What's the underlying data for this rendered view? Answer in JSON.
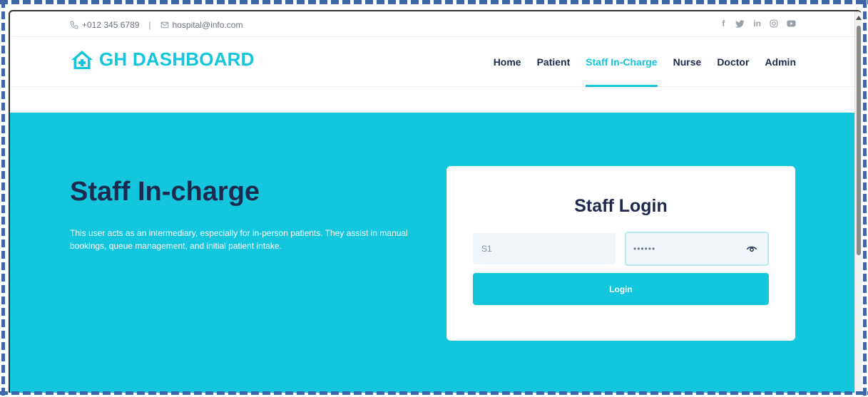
{
  "topbar": {
    "phone": "+012 345 6789",
    "separator": "|",
    "email": "hospital@info.com",
    "socials": [
      "facebook-icon",
      "twitter-icon",
      "linkedin-icon",
      "instagram-icon",
      "youtube-icon"
    ]
  },
  "brand": {
    "name": "GH DASHBOARD",
    "icon": "hospital-house-icon",
    "color": "#13c5dd"
  },
  "nav": {
    "items": [
      {
        "label": "Home"
      },
      {
        "label": "Patient"
      },
      {
        "label": "Staff In-Charge",
        "active": true
      },
      {
        "label": "Nurse"
      },
      {
        "label": "Doctor"
      },
      {
        "label": "Admin"
      }
    ]
  },
  "hero": {
    "title": "Staff In-charge",
    "description": "This user acts as an intermediary, especially for in-person patients. They assist in manual bookings, queue management, and initial patient intake."
  },
  "login": {
    "title": "Staff Login",
    "username_value": "S1",
    "password_value": "••••••",
    "button_label": "Login"
  },
  "colors": {
    "accent": "#13c5dd",
    "dark": "#1d2a4d"
  }
}
